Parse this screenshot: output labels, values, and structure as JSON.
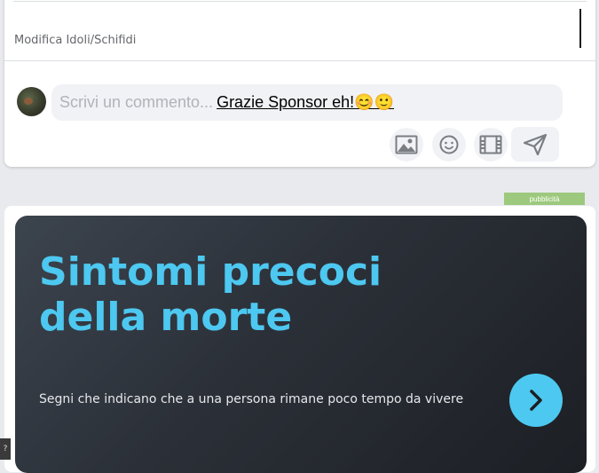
{
  "post_footer": {
    "edit_link": "Modifica Idoli/Schifidi"
  },
  "comment": {
    "placeholder": "Scrivi un commento...",
    "typed_text": "Grazie Sponsor eh!😊🙂",
    "tools": [
      "image-icon",
      "emoji-icon",
      "video-icon",
      "send-icon"
    ]
  },
  "ad": {
    "badge": "pubblicità",
    "title": "Sintomi precoci della morte",
    "subtitle": "Segni che indicano che a una persona rimane poco tempo da vivere",
    "accent": "#4dc8f0",
    "arrow": "chevron-right-icon"
  },
  "corner_tab": "?"
}
